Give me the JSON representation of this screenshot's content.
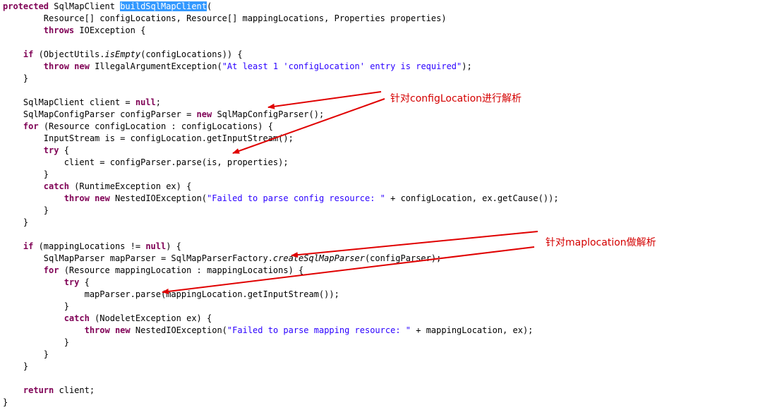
{
  "code": {
    "lines": [
      [
        {
          "t": "protected",
          "c": "kw"
        },
        {
          "t": " SqlMapClient "
        },
        {
          "t": "buildSqlMapClient",
          "c": "sel"
        },
        {
          "t": "("
        }
      ],
      [
        {
          "t": "        Resource[] configLocations, Resource[] mappingLocations, Properties properties)"
        }
      ],
      [
        {
          "t": "        "
        },
        {
          "t": "throws",
          "c": "kw"
        },
        {
          "t": " IOException {"
        }
      ],
      [
        {
          "t": ""
        }
      ],
      [
        {
          "t": "    "
        },
        {
          "t": "if",
          "c": "kw"
        },
        {
          "t": " (ObjectUtils."
        },
        {
          "t": "isEmpty",
          "c": "it"
        },
        {
          "t": "(configLocations)) {"
        }
      ],
      [
        {
          "t": "        "
        },
        {
          "t": "throw",
          "c": "kw"
        },
        {
          "t": " "
        },
        {
          "t": "new",
          "c": "kw"
        },
        {
          "t": " IllegalArgumentException("
        },
        {
          "t": "\"At least 1 'configLocation' entry is required\"",
          "c": "str"
        },
        {
          "t": ");"
        }
      ],
      [
        {
          "t": "    }"
        }
      ],
      [
        {
          "t": ""
        }
      ],
      [
        {
          "t": "    SqlMapClient client = "
        },
        {
          "t": "null",
          "c": "kw"
        },
        {
          "t": ";"
        }
      ],
      [
        {
          "t": "    SqlMapConfigParser configParser = "
        },
        {
          "t": "new",
          "c": "kw"
        },
        {
          "t": " SqlMapConfigParser();"
        }
      ],
      [
        {
          "t": "    "
        },
        {
          "t": "for",
          "c": "kw"
        },
        {
          "t": " (Resource configLocation : configLocations) {"
        }
      ],
      [
        {
          "t": "        InputStream is = configLocation.getInputStream();"
        }
      ],
      [
        {
          "t": "        "
        },
        {
          "t": "try",
          "c": "kw"
        },
        {
          "t": " {"
        }
      ],
      [
        {
          "t": "            client = configParser.parse(is, properties);"
        }
      ],
      [
        {
          "t": "        }"
        }
      ],
      [
        {
          "t": "        "
        },
        {
          "t": "catch",
          "c": "kw"
        },
        {
          "t": " (RuntimeException ex) {"
        }
      ],
      [
        {
          "t": "            "
        },
        {
          "t": "throw",
          "c": "kw"
        },
        {
          "t": " "
        },
        {
          "t": "new",
          "c": "kw"
        },
        {
          "t": " NestedIOException("
        },
        {
          "t": "\"Failed to parse config resource: \"",
          "c": "str"
        },
        {
          "t": " + configLocation, ex.getCause());"
        }
      ],
      [
        {
          "t": "        }"
        }
      ],
      [
        {
          "t": "    }"
        }
      ],
      [
        {
          "t": ""
        }
      ],
      [
        {
          "t": "    "
        },
        {
          "t": "if",
          "c": "kw"
        },
        {
          "t": " (mappingLocations != "
        },
        {
          "t": "null",
          "c": "kw"
        },
        {
          "t": ") {"
        }
      ],
      [
        {
          "t": "        SqlMapParser mapParser = SqlMapParserFactory."
        },
        {
          "t": "createSqlMapParser",
          "c": "it"
        },
        {
          "t": "(configParser);"
        }
      ],
      [
        {
          "t": "        "
        },
        {
          "t": "for",
          "c": "kw"
        },
        {
          "t": " (Resource mappingLocation : mappingLocations) {"
        }
      ],
      [
        {
          "t": "            "
        },
        {
          "t": "try",
          "c": "kw"
        },
        {
          "t": " {"
        }
      ],
      [
        {
          "t": "                mapParser.parse(mappingLocation.getInputStream());"
        }
      ],
      [
        {
          "t": "            }"
        }
      ],
      [
        {
          "t": "            "
        },
        {
          "t": "catch",
          "c": "kw"
        },
        {
          "t": " (NodeletException ex) {"
        }
      ],
      [
        {
          "t": "                "
        },
        {
          "t": "throw",
          "c": "kw"
        },
        {
          "t": " "
        },
        {
          "t": "new",
          "c": "kw"
        },
        {
          "t": " NestedIOException("
        },
        {
          "t": "\"Failed to parse mapping resource: \"",
          "c": "str"
        },
        {
          "t": " + mappingLocation, ex);"
        }
      ],
      [
        {
          "t": "            }"
        }
      ],
      [
        {
          "t": "        }"
        }
      ],
      [
        {
          "t": "    }"
        }
      ],
      [
        {
          "t": ""
        }
      ],
      [
        {
          "t": "    "
        },
        {
          "t": "return",
          "c": "kw"
        },
        {
          "t": " client;"
        }
      ],
      [
        {
          "t": "}"
        }
      ]
    ]
  },
  "annotations": {
    "config_note": "针对configLocation进行解析",
    "mapping_note": "针对maplocation做解析",
    "arrow_color": "#e00000"
  }
}
